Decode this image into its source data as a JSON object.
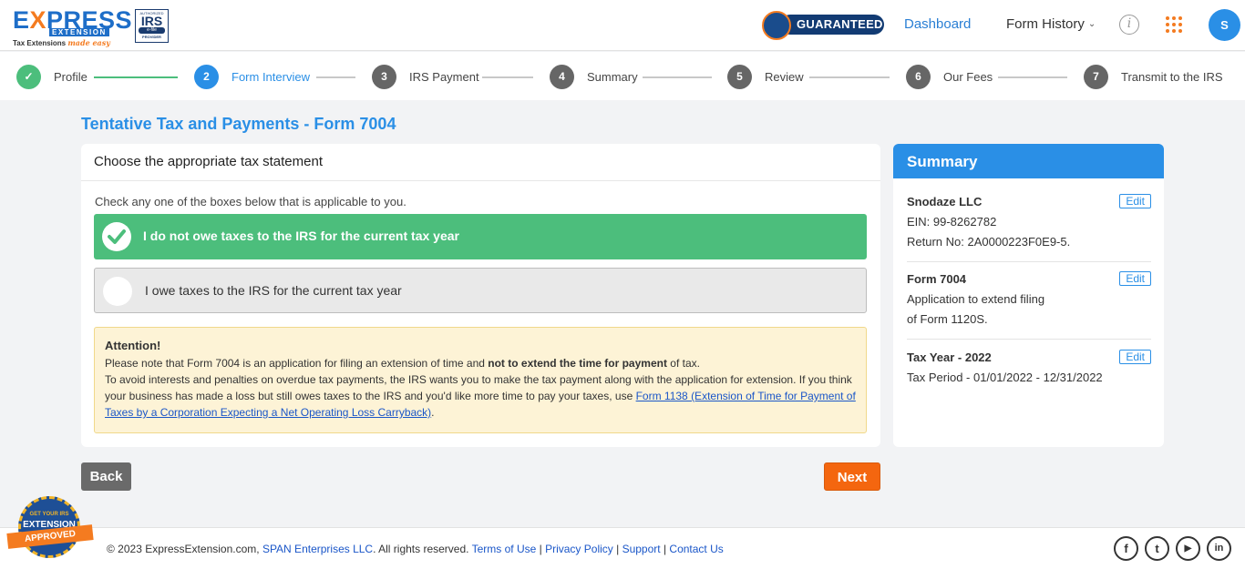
{
  "header": {
    "logo_text_left": "E",
    "logo_text_x": "X",
    "logo_text_rest": "PRESS",
    "logo_sub": "EXTENSION",
    "logo_tagline": "Tax Extensions",
    "logo_tagline_accent": "made easy",
    "irs_authorized": "AUTHORIZED",
    "irs_label": "IRS",
    "irs_efile": "e-file",
    "irs_provider": "PROVIDER",
    "guaranteed": "GUARANTEED",
    "nav_dashboard": "Dashboard",
    "nav_form_history": "Form History",
    "avatar_initial": "S"
  },
  "stepper": {
    "steps": [
      {
        "num": "✓",
        "label": "Profile",
        "state": "done"
      },
      {
        "num": "2",
        "label": "Form Interview",
        "state": "active"
      },
      {
        "num": "3",
        "label": "IRS Payment",
        "state": "todo"
      },
      {
        "num": "4",
        "label": "Summary",
        "state": "todo"
      },
      {
        "num": "5",
        "label": "Review",
        "state": "todo"
      },
      {
        "num": "6",
        "label": "Our Fees",
        "state": "todo"
      },
      {
        "num": "7",
        "label": "Transmit to the IRS",
        "state": "todo"
      }
    ]
  },
  "main": {
    "page_title": "Tentative Tax and Payments - Form 7004",
    "card_title": "Choose the appropriate tax statement",
    "instruction": "Check any one of the boxes below that is applicable to you.",
    "option_no_owe": "I do not owe taxes to the IRS for the current tax year",
    "option_owe": "I owe taxes to the IRS for the current tax year",
    "attention": {
      "title": "Attention!",
      "line1_a": "Please note that Form 7004 is an application for filing an extension of time and ",
      "line1_bold": "not to extend the time for payment",
      "line1_b": " of tax.",
      "line2": "To avoid interests and penalties on overdue tax payments, the IRS wants you to make the tax payment along with the application for extension. If you think your business has made a loss but still owes taxes to the IRS and you'd like more time to pay your taxes, use ",
      "link": "Form 1138 (Extension of Time for Payment of Taxes by a Corporation Expecting a Net Operating Loss Carryback)",
      "line2_end": "."
    },
    "back_label": "Back",
    "next_label": "Next"
  },
  "summary": {
    "title": "Summary",
    "edit_label": "Edit",
    "business": {
      "name": "Snodaze LLC",
      "ein": "EIN: 99-8262782",
      "return_no": "Return No: 2A0000223F0E9-5."
    },
    "form": {
      "name": "Form 7004",
      "line1": "Application to extend filing",
      "line2": "of Form 1120S."
    },
    "tax_year": {
      "name": "Tax Year - 2022",
      "period": "Tax Period - 01/01/2022 - 12/31/2022"
    }
  },
  "footer": {
    "copyright": "© 2023 ExpressExtension.com, ",
    "span": "SPAN Enterprises LLC",
    "rights": ". All rights reserved. ",
    "terms": "Terms of Use",
    "privacy": "Privacy Policy",
    "support": "Support",
    "contact": "Contact Us",
    "sep": " | ",
    "badge_top": "GET YOUR IRS",
    "badge_mid": "EXTENSION",
    "badge_ribbon": "APPROVED",
    "social": [
      "f",
      "t",
      "▶",
      "in"
    ]
  },
  "colors": {
    "primary": "#2a8fe6",
    "success": "#4cbe7c",
    "accent": "#f47b20",
    "warning_bg": "#fdf3d6"
  }
}
